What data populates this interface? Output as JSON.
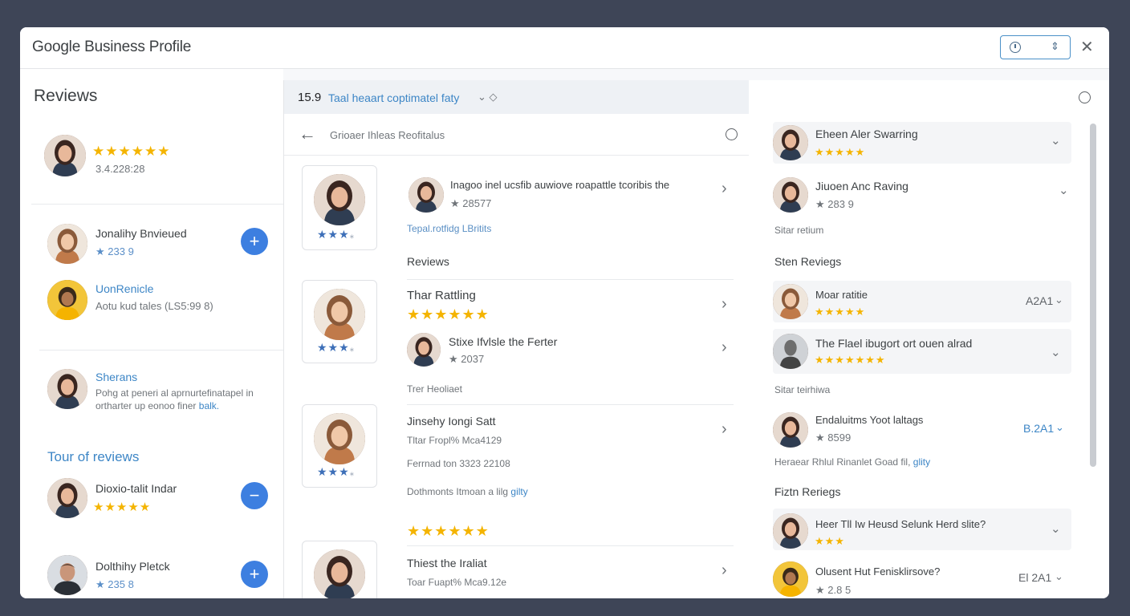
{
  "app_title": "Google Business Profile",
  "title_icons": [
    "clock-icon",
    "sort-icon",
    "close-icon"
  ],
  "colors": {
    "accent": "#3d7fe0",
    "star": "#f4b400",
    "window_bg": "#3e4557"
  },
  "left": {
    "heading": "Reviews",
    "profile": {
      "stars": "★★★★★★",
      "subtitle": "3.4.228:28"
    },
    "users": [
      {
        "name": "Jonalihy Bnvieued",
        "rating": "★ 233 9"
      },
      {
        "name": "UonRenicle",
        "detail": "Aotu kud tales (LS5:99 8)"
      },
      {
        "name": "Sherans",
        "detail1": "Pohg at peneri al aprnurtefinatapel in",
        "detail2": "ortharter up eonoo finer",
        "link": "balk."
      }
    ],
    "section_title": "Tour of reviews",
    "bottom_users": [
      {
        "name": "Dioxio-talit Indar",
        "stars": "★★★★★"
      },
      {
        "name": "Dolthihy Pletck",
        "rating": "★ 235 8"
      }
    ],
    "plus_label": "+",
    "minus_label": "−"
  },
  "middle": {
    "bar_title": "15.9",
    "bar_subtitle": "Taal heaart coptimatel faty",
    "bar_caret": "⌄ ◇",
    "back_icon": "←",
    "breadcrumb": "Grioaer Ihleas Reofitalus",
    "chevron": "›",
    "card_stars": "★★★",
    "card_star_tail": "⁎",
    "items": [
      {
        "title": "Inagoo inel ucsfib auwiove roapattle tcoribis the",
        "rating": "★ 28577"
      },
      {
        "link": "Tepal.rotfidg LBritits"
      },
      {
        "heading": "Reviews"
      },
      {
        "title": "Thar Rattling",
        "stars": "★★★★★★"
      },
      {
        "title": "Stixe Ifvlsle the Ferter",
        "rating": "★ 2037"
      },
      {
        "label": "Trer Heoliaet"
      },
      {
        "title": "Jinsehy Iongi Satt",
        "line1": "Tltar Fropl% Mca4129",
        "line2": "Ferrnad ton 3323 22108",
        "line3": "Dothmonts Itmoan a lilg",
        "link": "gilty"
      },
      {
        "stars": "★★★★★★"
      },
      {
        "title": "Thiest the Iraliat",
        "line1": "Toar Fuapt% Mca9.12e"
      }
    ]
  },
  "right": {
    "top_icon": "info-icon",
    "rows": [
      {
        "name": "Eheen Aler Swarring",
        "stars": "★★★★★"
      },
      {
        "name": "Jiuoen Anc Raving",
        "rating": "★ 283 9"
      }
    ],
    "label1": "Sitar retium",
    "section1": "Sten Reviegs",
    "rows2": [
      {
        "name": "Moar ratitie",
        "stars": "★★★★★",
        "value": "A2A1"
      },
      {
        "name": "The Flael ibugort ort ouen alrad",
        "stars": "★★★★★★★"
      }
    ],
    "label2": "Sitar teirhiwa",
    "rows3": [
      {
        "name": "Endaluitms Yoot laltags",
        "rating": "★ 8599",
        "value": "B.2A1"
      }
    ],
    "note": "Heraear Rhlul Rinanlet Goad fil,",
    "note_link": "glity",
    "section2": "Fiztn Reriegs",
    "rows4": [
      {
        "name": "Heer Tll Iw Heusd Selunk Herd slite?",
        "stars": "★★★"
      },
      {
        "name": "Olusent Hut Fenisklirsove?",
        "rating": "★ 2.8 5",
        "value": "El 2A1"
      }
    ],
    "caret": "⌄"
  }
}
